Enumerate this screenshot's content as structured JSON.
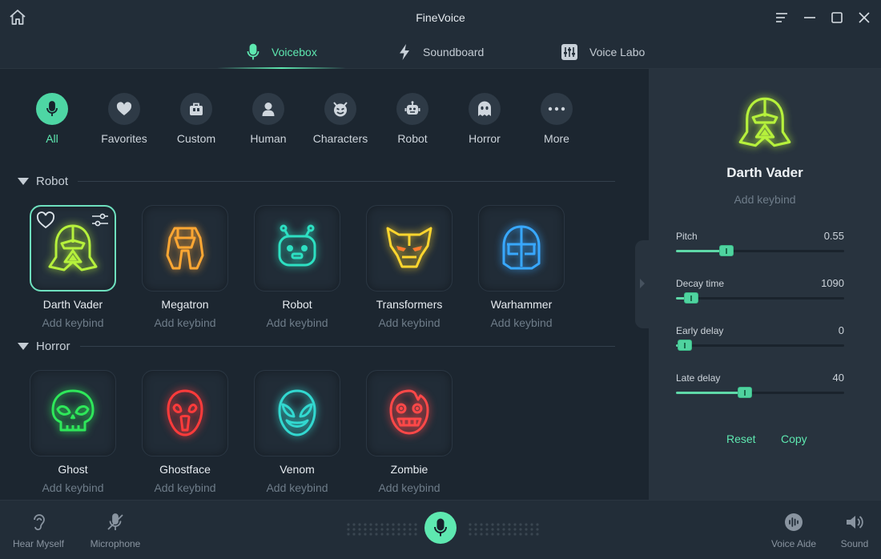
{
  "app": {
    "title": "FineVoice"
  },
  "tabs": [
    {
      "label": "Voicebox",
      "active": true
    },
    {
      "label": "Soundboard",
      "active": false
    },
    {
      "label": "Voice Labo",
      "active": false
    }
  ],
  "categories": [
    {
      "label": "All",
      "icon": "microphone-icon",
      "active": true
    },
    {
      "label": "Favorites",
      "icon": "heart-icon"
    },
    {
      "label": "Custom",
      "icon": "briefcase-icon"
    },
    {
      "label": "Human",
      "icon": "person-icon"
    },
    {
      "label": "Characters",
      "icon": "devil-face-icon"
    },
    {
      "label": "Robot",
      "icon": "robot-icon"
    },
    {
      "label": "Horror",
      "icon": "ghost-icon"
    },
    {
      "label": "More",
      "icon": "more-dots-icon"
    }
  ],
  "sections": [
    {
      "title": "Robot",
      "voices": [
        {
          "name": "Darth Vader",
          "keybind": "Add keybind",
          "selected": true,
          "icon": "darth-vader-helmet-icon",
          "color": "#b6f13c"
        },
        {
          "name": "Megatron",
          "keybind": "Add keybind",
          "icon": "megatron-helmet-icon",
          "color": "#ffa733"
        },
        {
          "name": "Robot",
          "keybind": "Add keybind",
          "icon": "robot-head-icon",
          "color": "#2de0c2"
        },
        {
          "name": "Transformers",
          "keybind": "Add keybind",
          "icon": "transformers-mask-icon",
          "color": "#ffd62e"
        },
        {
          "name": "Warhammer",
          "keybind": "Add keybind",
          "icon": "warhammer-helmet-icon",
          "color": "#38a8ff"
        }
      ]
    },
    {
      "title": "Horror",
      "voices": [
        {
          "name": "Ghost",
          "keybind": "Add keybind",
          "icon": "ghost-skull-icon",
          "color": "#2ee85a"
        },
        {
          "name": "Ghostface",
          "keybind": "Add keybind",
          "icon": "ghostface-mask-icon",
          "color": "#ff3b3b"
        },
        {
          "name": "Venom",
          "keybind": "Add keybind",
          "icon": "venom-face-icon",
          "color": "#32d8d0"
        },
        {
          "name": "Zombie",
          "keybind": "Add keybind",
          "icon": "zombie-face-icon",
          "color": "#ff4848"
        }
      ]
    }
  ],
  "panel": {
    "name": "Darth Vader",
    "keybind": "Add keybind",
    "sliders": [
      {
        "label": "Pitch",
        "value": "0.55",
        "level": 0.3
      },
      {
        "label": "Decay time",
        "value": "1090",
        "level": 0.09
      },
      {
        "label": "Early delay",
        "value": "0",
        "level": 0.05
      },
      {
        "label": "Late delay",
        "value": "40",
        "level": 0.41
      }
    ],
    "reset_label": "Reset",
    "copy_label": "Copy"
  },
  "bottom": {
    "hear_myself": "Hear Myself",
    "microphone": "Microphone",
    "voice_aide": "Voice Aide",
    "sound": "Sound"
  },
  "colors": {
    "accent": "#5ee8b0",
    "background": "#1c2630",
    "panel": "#28333e"
  }
}
